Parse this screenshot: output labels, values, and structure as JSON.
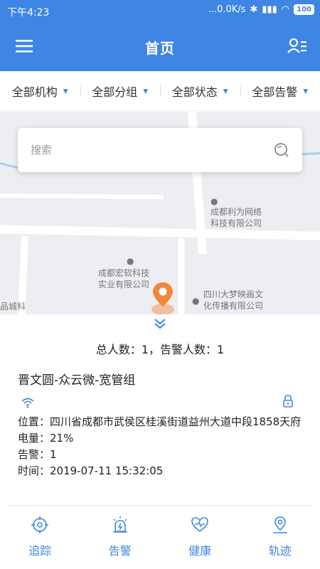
{
  "status": {
    "time": "下午4:23",
    "network": "...0.0K/s",
    "battery": "100"
  },
  "header": {
    "title": "首页"
  },
  "filters": [
    {
      "label": "全部机构"
    },
    {
      "label": "全部分组"
    },
    {
      "label": "全部状态"
    },
    {
      "label": "全部告警"
    }
  ],
  "search": {
    "placeholder": "搜索"
  },
  "map": {
    "pois": [
      {
        "text": "成都利为网络\n科技有限公司"
      },
      {
        "text": "成都宏软科技\n实业有限公司"
      },
      {
        "text": "四川大梦映画文\n化传播有限公司"
      },
      {
        "text": "品城科"
      }
    ]
  },
  "panel": {
    "totals": "总人数：1，告警人数：1",
    "group_title": "晋文圆-众云微-宽管组",
    "location": "位置：四川省成都市武侯区桂溪街道益州大道中段1858天府",
    "battery": "电量：21%",
    "alarm": "告警：1",
    "time": "时间：2019-07-11 15:32:05"
  },
  "nav": [
    {
      "label": "追踪",
      "icon": "crosshair-icon"
    },
    {
      "label": "告警",
      "icon": "alarm-siren-icon"
    },
    {
      "label": "健康",
      "icon": "health-heart-icon"
    },
    {
      "label": "轨迹",
      "icon": "track-pin-icon"
    }
  ],
  "colors": {
    "primary": "#3f86e4",
    "pin": "#f0873a"
  }
}
